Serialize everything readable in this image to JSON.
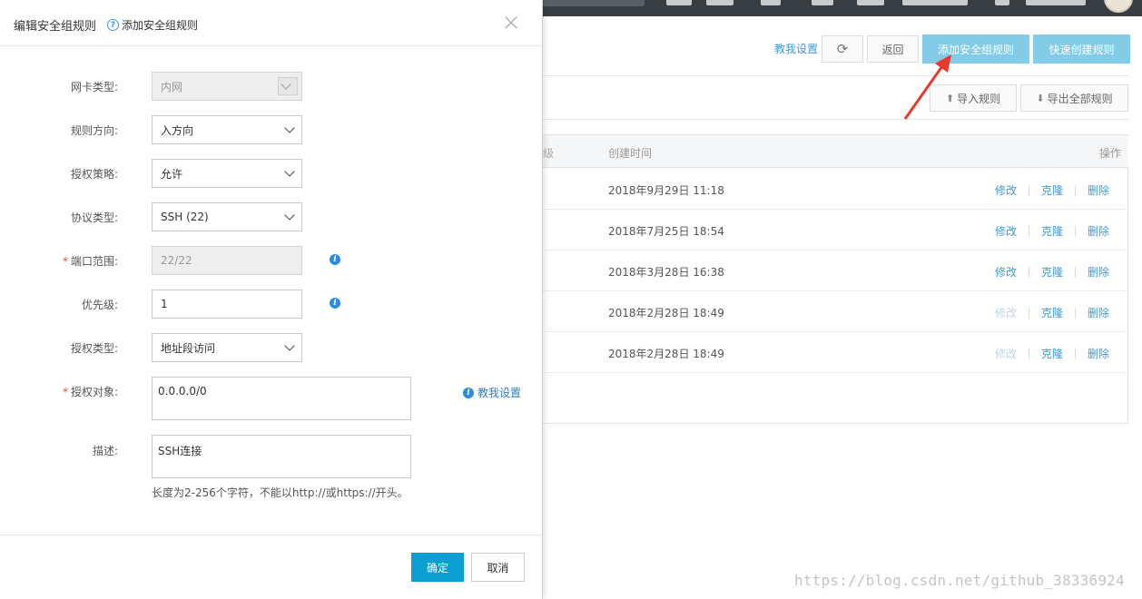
{
  "modal": {
    "title": "编辑安全组规则",
    "help_label": "添加安全组规则",
    "fields": [
      {
        "label": "网卡类型:",
        "value": "内网"
      },
      {
        "label": "规则方向:",
        "value": "入方向"
      },
      {
        "label": "授权策略:",
        "value": "允许"
      },
      {
        "label": "协议类型:",
        "value": "SSH (22)"
      },
      {
        "label": "端口范围:",
        "value": "22/22"
      },
      {
        "label": "优先级:",
        "value": "1"
      },
      {
        "label": "授权类型:",
        "value": "地址段访问"
      },
      {
        "label": "授权对象:",
        "value": "0.0.0.0/0"
      },
      {
        "label": "描述:",
        "value": "SSH连接"
      }
    ],
    "teach_label": "教我设置",
    "hint": "长度为2-256个字符，不能以http://或https://开头。",
    "ok_label": "确定",
    "cancel_label": "取消"
  },
  "page": {
    "teach_link": "教我设置",
    "back_label": "返回",
    "add_rule_label": "添加安全组规则",
    "quick_rule_label": "快速创建规则",
    "import_label": "导入规则",
    "export_label": "导出全部规则",
    "table": {
      "col_fragment": "级",
      "col_time": "创建时间",
      "col_op": "操作",
      "rows": [
        {
          "time": "2018年9月29日 11:18",
          "edit": "修改",
          "clone": "克隆",
          "delete": "删除"
        },
        {
          "time": "2018年7月25日 18:54",
          "edit": "修改",
          "clone": "克隆",
          "delete": "删除"
        },
        {
          "time": "2018年3月28日 16:38",
          "edit": "修改",
          "clone": "克隆",
          "delete": "删除"
        },
        {
          "time": "2018年2月28日 18:49",
          "edit": "修改",
          "clone": "克隆",
          "delete": "删除"
        },
        {
          "time": "2018年2月28日 18:49",
          "edit": "修改",
          "clone": "克隆",
          "delete": "删除"
        }
      ]
    },
    "watermark": "https://blog.csdn.net/github_38336924"
  },
  "colors": {
    "primary": "#0c9dd1",
    "light_primary": "#82cce8",
    "link": "#3f9ad6",
    "required": "#e14a2f",
    "arrow": "#e8392c"
  },
  "icons": {
    "help": "question-circle-icon",
    "info": "info-circle-icon",
    "close": "close-icon",
    "refresh": "refresh-icon",
    "import": "upload-icon",
    "export": "download-icon"
  }
}
